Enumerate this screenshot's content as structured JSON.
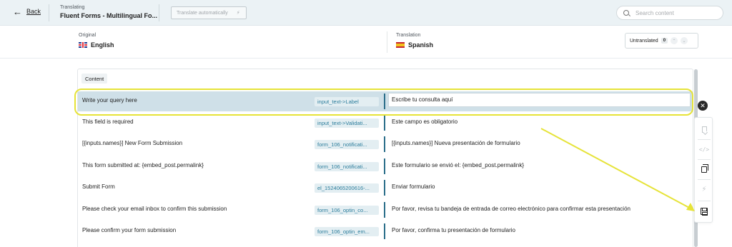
{
  "topbar": {
    "back_label": "Back",
    "translating_label": "Translating",
    "form_title": "Fluent Forms - Multilingual Fo...",
    "translate_auto_label": "Translate automatically",
    "search_placeholder": "Search content"
  },
  "languages": {
    "original_label": "Original",
    "original_name": "English",
    "translation_label": "Translation",
    "translation_name": "Spanish",
    "untranslated_label": "Untranslated",
    "untranslated_count": "0"
  },
  "content_tag": "Content",
  "rows": [
    {
      "source": "Write your query here",
      "key": "input_text->Label",
      "translation": "Escribe tu consulta aquí"
    },
    {
      "source": "This field is required",
      "key": "input_text->Validati...",
      "translation": "Este campo es obligatorio"
    },
    {
      "source": "[{inputs.names}] New Form Submission",
      "key": "form_106_notificati...",
      "translation": "[{inputs.names}] Nueva presentación de formulario"
    },
    {
      "source": "This form submitted at: {embed_post.permalink}",
      "key": "form_106_notificati...",
      "translation": "Este formulario se envió el: {embed_post.permalink}"
    },
    {
      "source": "Submit Form",
      "key": "el_1524065200616-...",
      "translation": "Enviar formulario"
    },
    {
      "source": "Please check your email inbox to confirm this submission",
      "key": "form_106_optin_co...",
      "translation": "Por favor, revisa tu bandeja de entrada de correo electrónico para confirmar esta presentación"
    },
    {
      "source": "Please confirm your form submission",
      "key": "form_106_optin_em...",
      "translation": "Por favor, confirma tu presentación de formulario"
    }
  ],
  "colors": {
    "annotation": "#e6e338",
    "key_text": "#2c7d9c",
    "active_row": "#cfe0e8"
  },
  "icons": {
    "back": "arrow-left-icon",
    "search": "search-icon",
    "close": "close-icon",
    "bookmark": "bookmark-icon",
    "code": "code-icon",
    "copy": "copy-icon",
    "bolt": "bolt-icon",
    "save": "save-icon"
  }
}
